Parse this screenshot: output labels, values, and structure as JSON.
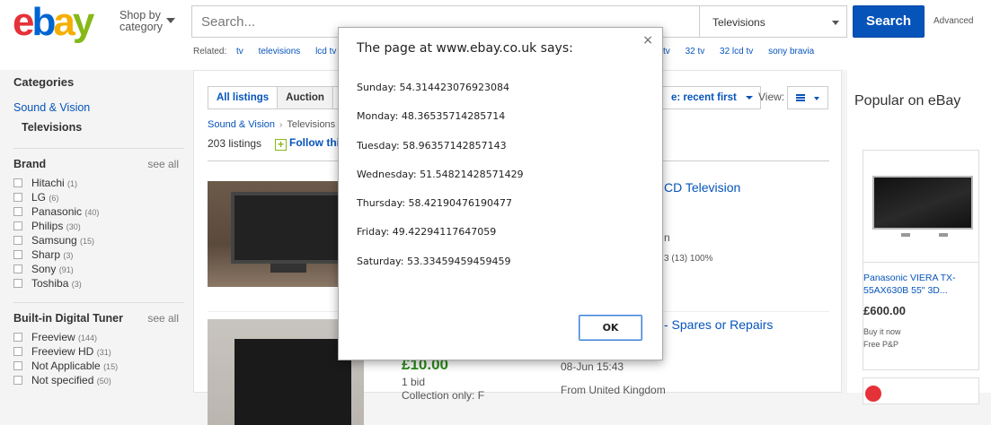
{
  "header": {
    "logo": {
      "e": "e",
      "b": "b",
      "a": "a",
      "y": "y"
    },
    "shop_by_line1": "Shop by",
    "shop_by_line2": "category",
    "search_placeholder": "Search...",
    "category_selected": "Televisions",
    "search_button": "Search",
    "advanced": "Advanced",
    "related_label": "Related:",
    "related_links_left": [
      "tv",
      "televisions",
      "lcd tv"
    ],
    "related_links_right": [
      "tv",
      "32 tv",
      "32 lcd tv",
      "sony bravia"
    ]
  },
  "sidebar": {
    "categories_heading": "Categories",
    "parent_category": "Sound & Vision",
    "current_category": "Televisions",
    "brand_heading": "Brand",
    "see_all": "see all",
    "brands": [
      {
        "label": "Hitachi",
        "count": "(1)"
      },
      {
        "label": "LG",
        "count": "(6)"
      },
      {
        "label": "Panasonic",
        "count": "(40)"
      },
      {
        "label": "Philips",
        "count": "(30)"
      },
      {
        "label": "Samsung",
        "count": "(15)"
      },
      {
        "label": "Sharp",
        "count": "(3)"
      },
      {
        "label": "Sony",
        "count": "(91)"
      },
      {
        "label": "Toshiba",
        "count": "(3)"
      }
    ],
    "tuner_heading": "Built-in Digital Tuner",
    "tuners": [
      {
        "label": "Freeview",
        "count": "(144)"
      },
      {
        "label": "Freeview HD",
        "count": "(31)"
      },
      {
        "label": "Not Applicable",
        "count": "(15)"
      },
      {
        "label": "Not specified",
        "count": "(50)"
      }
    ]
  },
  "main": {
    "tabs": [
      "All listings",
      "Auction"
    ],
    "sort_label": "e: recent first",
    "view_label": "View:",
    "breadcrumb": [
      "Sound & Vision",
      "Televisions"
    ],
    "listing_count": "203 listings",
    "follow": "Follow thi",
    "items": [
      {
        "title": "CD Television",
        "line2": "n",
        "line3": "3 (13) 100%"
      },
      {
        "title": "- Spares or Repairs",
        "price": "£10.00",
        "bids": "1 bid",
        "collection": "Collection only: F",
        "time": "08-Jun 15:43",
        "location": "From United Kingdom"
      }
    ]
  },
  "popular": {
    "title": "Popular on eBay",
    "item_title": "Panasonic VIERA TX-55AX630B 55\" 3D...",
    "item_price": "£600.00",
    "item_buy": "Buy it now",
    "item_shipping": "Free P&P"
  },
  "dialog": {
    "title": "The page at www.ebay.co.uk says:",
    "lines": [
      "Sunday: 54.314423076923084",
      "Monday: 48.36535714285714",
      "Tuesday: 58.96357142857143",
      "Wednesday: 51.54821428571429",
      "Thursday: 58.42190476190477",
      "Friday: 49.42294117647059",
      "Saturday: 53.33459459459459"
    ],
    "ok": "OK",
    "close": "×"
  }
}
